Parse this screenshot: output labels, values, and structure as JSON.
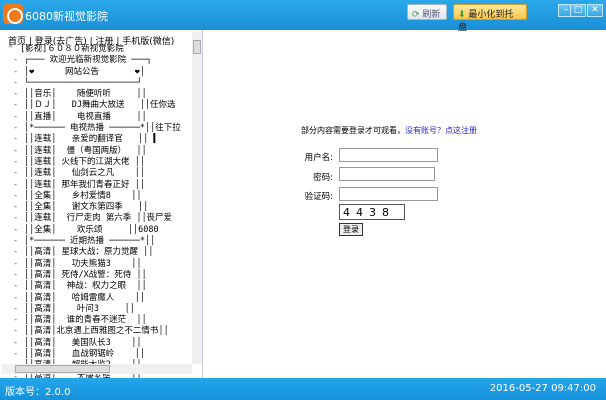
{
  "window": {
    "title": "6080新视觉影院",
    "refresh_label": "刷新",
    "minimize_tray_label": "最小化到托盘"
  },
  "tree": {
    "nav": "首页 | 登录(去广告) | 注册 | 手机版(微信)",
    "root": "[影视]６０８０新视觉影院",
    "rows": [
      "┌─── 欢迎光临新视觉影院 ───┐",
      "│❤      网站公告       ❤│",
      "└─────────────────────┘",
      "││音乐│    随便听听     ││",
      "││ＤＪ│   DJ舞曲大放送   ││任你选",
      "││直播│    电视直播     ││",
      "│*────── 电视热播 ──────*││往下拉",
      "││连载│   亲爱的翻译官   ││ ▍",
      "││连载│  僵（粤国两版）  ││",
      "││连载│ 火线下的江湖大佬 ││",
      "││连载│   仙剑云之凡    ││",
      "││连载│ 那年我们青春正好 ││",
      "││全集│   乡村爱情8    ││",
      "││全集│   谢文东第四季   ││",
      "││连载│  行尸走肉 第六季 ││丧尸爱",
      "││全集│    欢乐颂     ││6080",
      "│*────── 近期热播 ──────*││",
      "││高清│ 星球大战：原力觉醒 ││",
      "││高清│   功夫熊猫3    ││",
      "││高清│ 死侍/X战警：死侍 ││",
      "││高清│  神战：权力之眼  ││",
      "││高清│   哈姆雷魔人    ││",
      "││高清│    叶问3     ││",
      "││高清│  谁的青春不迷茫  ││",
      "││高清│北京遇上西雅图之不二情书││",
      "││高清│   美国队长3    ││",
      "││高清│   血战钢锯岭    ││",
      "││高清│   超能太监2    ││",
      "││高清│    大唐玄奘    ││"
    ]
  },
  "login": {
    "notice": "部分内容需要登录才可观看，",
    "register_link": "没有账号？点这注册",
    "username_label": "用户名:",
    "password_label": "密码:",
    "captcha_label": "验证码:",
    "username_value": "",
    "password_value": "",
    "captcha_value": "",
    "captcha_image_text": "4438",
    "login_button": "登录"
  },
  "status": {
    "version": "版本号：2.0.0",
    "datetime": "2016-05-27 09:47:00"
  }
}
